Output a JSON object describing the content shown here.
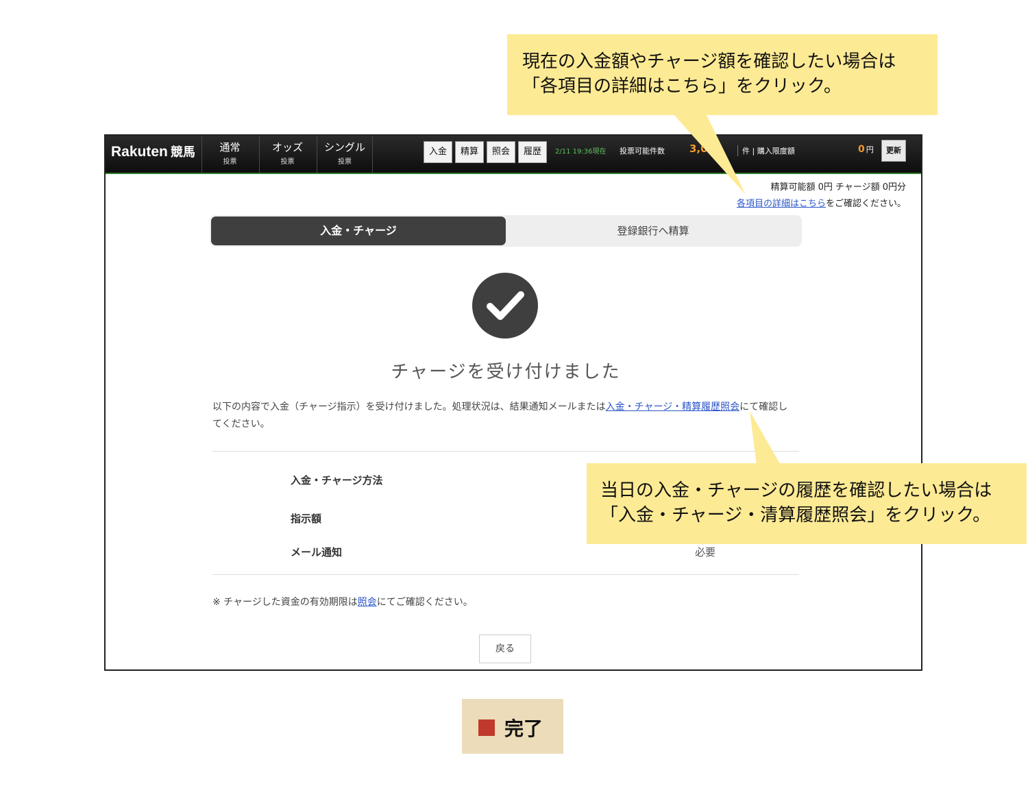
{
  "annotations": {
    "top_line1": "現在の入金額やチャージ額を確認したい場合は",
    "top_line2": "「各項目の詳細はこちら」をクリック。",
    "bottom_line1": "当日の入金・チャージの履歴を確認したい場合は",
    "bottom_line2": "「入金・チャージ・清算履歴照会」をクリック。"
  },
  "header": {
    "logo_text": "Rakuten",
    "logo_kanji": "競馬",
    "nav": [
      {
        "main": "通常",
        "sub": "投票"
      },
      {
        "main": "オッズ",
        "sub": "投票"
      },
      {
        "main": "シングル",
        "sub": "投票"
      }
    ],
    "actions": [
      "入金",
      "精算",
      "照会",
      "履歴"
    ],
    "status_time": "2/11 19:36現在",
    "status_label": "投票可能件数",
    "status_count": "3,0",
    "status_label2": "件 | 購入限度額",
    "limit_amount": "0",
    "limit_unit": "円",
    "refresh_label": "更新"
  },
  "balance": {
    "line": "精算可能額 0円 チャージ額 0円分",
    "detail_link": "各項目の詳細はこちら",
    "detail_suffix": "をご確認ください。"
  },
  "tabs": {
    "active": "入金・チャージ",
    "inactive": "登録銀行へ精算"
  },
  "completion": {
    "title": "チャージを受け付けました",
    "message_prefix": "以下の内容で入金（チャージ指示）を受け付けました。処理状況は、結果通知メールまたは",
    "message_link": "入金・チャージ・精算履歴照会",
    "message_suffix": "にて確認してください。"
  },
  "details": [
    {
      "label": "入金・チャージ方法",
      "value": ""
    },
    {
      "label": "指示額",
      "value": ""
    },
    {
      "label": "メール通知",
      "value": "必要"
    }
  ],
  "note": {
    "prefix": "※ チャージした資金の有効期限は",
    "link": "照会",
    "suffix": "にてご確認ください。"
  },
  "back_label": "戻る",
  "step": {
    "label": "完了",
    "color": "#c0392b"
  }
}
